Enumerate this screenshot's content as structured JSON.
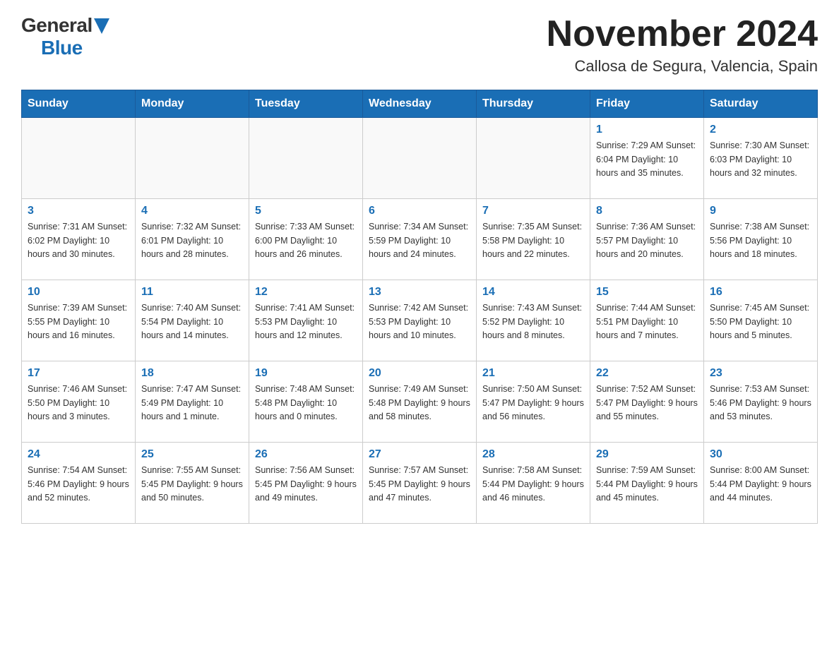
{
  "logo": {
    "general": "General",
    "blue": "Blue"
  },
  "title": "November 2024",
  "location": "Callosa de Segura, Valencia, Spain",
  "days_of_week": [
    "Sunday",
    "Monday",
    "Tuesday",
    "Wednesday",
    "Thursday",
    "Friday",
    "Saturday"
  ],
  "weeks": [
    [
      {
        "day": "",
        "info": ""
      },
      {
        "day": "",
        "info": ""
      },
      {
        "day": "",
        "info": ""
      },
      {
        "day": "",
        "info": ""
      },
      {
        "day": "",
        "info": ""
      },
      {
        "day": "1",
        "info": "Sunrise: 7:29 AM\nSunset: 6:04 PM\nDaylight: 10 hours and 35 minutes."
      },
      {
        "day": "2",
        "info": "Sunrise: 7:30 AM\nSunset: 6:03 PM\nDaylight: 10 hours and 32 minutes."
      }
    ],
    [
      {
        "day": "3",
        "info": "Sunrise: 7:31 AM\nSunset: 6:02 PM\nDaylight: 10 hours and 30 minutes."
      },
      {
        "day": "4",
        "info": "Sunrise: 7:32 AM\nSunset: 6:01 PM\nDaylight: 10 hours and 28 minutes."
      },
      {
        "day": "5",
        "info": "Sunrise: 7:33 AM\nSunset: 6:00 PM\nDaylight: 10 hours and 26 minutes."
      },
      {
        "day": "6",
        "info": "Sunrise: 7:34 AM\nSunset: 5:59 PM\nDaylight: 10 hours and 24 minutes."
      },
      {
        "day": "7",
        "info": "Sunrise: 7:35 AM\nSunset: 5:58 PM\nDaylight: 10 hours and 22 minutes."
      },
      {
        "day": "8",
        "info": "Sunrise: 7:36 AM\nSunset: 5:57 PM\nDaylight: 10 hours and 20 minutes."
      },
      {
        "day": "9",
        "info": "Sunrise: 7:38 AM\nSunset: 5:56 PM\nDaylight: 10 hours and 18 minutes."
      }
    ],
    [
      {
        "day": "10",
        "info": "Sunrise: 7:39 AM\nSunset: 5:55 PM\nDaylight: 10 hours and 16 minutes."
      },
      {
        "day": "11",
        "info": "Sunrise: 7:40 AM\nSunset: 5:54 PM\nDaylight: 10 hours and 14 minutes."
      },
      {
        "day": "12",
        "info": "Sunrise: 7:41 AM\nSunset: 5:53 PM\nDaylight: 10 hours and 12 minutes."
      },
      {
        "day": "13",
        "info": "Sunrise: 7:42 AM\nSunset: 5:53 PM\nDaylight: 10 hours and 10 minutes."
      },
      {
        "day": "14",
        "info": "Sunrise: 7:43 AM\nSunset: 5:52 PM\nDaylight: 10 hours and 8 minutes."
      },
      {
        "day": "15",
        "info": "Sunrise: 7:44 AM\nSunset: 5:51 PM\nDaylight: 10 hours and 7 minutes."
      },
      {
        "day": "16",
        "info": "Sunrise: 7:45 AM\nSunset: 5:50 PM\nDaylight: 10 hours and 5 minutes."
      }
    ],
    [
      {
        "day": "17",
        "info": "Sunrise: 7:46 AM\nSunset: 5:50 PM\nDaylight: 10 hours and 3 minutes."
      },
      {
        "day": "18",
        "info": "Sunrise: 7:47 AM\nSunset: 5:49 PM\nDaylight: 10 hours and 1 minute."
      },
      {
        "day": "19",
        "info": "Sunrise: 7:48 AM\nSunset: 5:48 PM\nDaylight: 10 hours and 0 minutes."
      },
      {
        "day": "20",
        "info": "Sunrise: 7:49 AM\nSunset: 5:48 PM\nDaylight: 9 hours and 58 minutes."
      },
      {
        "day": "21",
        "info": "Sunrise: 7:50 AM\nSunset: 5:47 PM\nDaylight: 9 hours and 56 minutes."
      },
      {
        "day": "22",
        "info": "Sunrise: 7:52 AM\nSunset: 5:47 PM\nDaylight: 9 hours and 55 minutes."
      },
      {
        "day": "23",
        "info": "Sunrise: 7:53 AM\nSunset: 5:46 PM\nDaylight: 9 hours and 53 minutes."
      }
    ],
    [
      {
        "day": "24",
        "info": "Sunrise: 7:54 AM\nSunset: 5:46 PM\nDaylight: 9 hours and 52 minutes."
      },
      {
        "day": "25",
        "info": "Sunrise: 7:55 AM\nSunset: 5:45 PM\nDaylight: 9 hours and 50 minutes."
      },
      {
        "day": "26",
        "info": "Sunrise: 7:56 AM\nSunset: 5:45 PM\nDaylight: 9 hours and 49 minutes."
      },
      {
        "day": "27",
        "info": "Sunrise: 7:57 AM\nSunset: 5:45 PM\nDaylight: 9 hours and 47 minutes."
      },
      {
        "day": "28",
        "info": "Sunrise: 7:58 AM\nSunset: 5:44 PM\nDaylight: 9 hours and 46 minutes."
      },
      {
        "day": "29",
        "info": "Sunrise: 7:59 AM\nSunset: 5:44 PM\nDaylight: 9 hours and 45 minutes."
      },
      {
        "day": "30",
        "info": "Sunrise: 8:00 AM\nSunset: 5:44 PM\nDaylight: 9 hours and 44 minutes."
      }
    ]
  ]
}
